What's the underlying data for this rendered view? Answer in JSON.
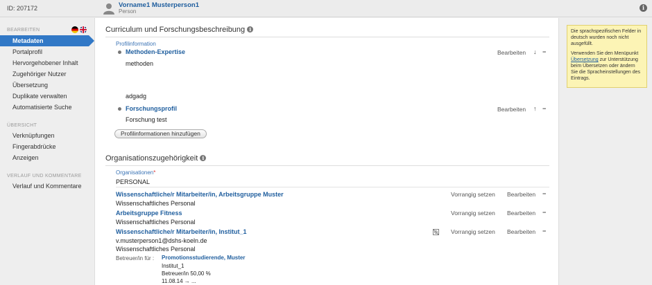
{
  "header": {
    "id_label": "ID: 207172",
    "person_name": "Vorname1 Musterperson1",
    "person_type": "Person"
  },
  "sidebar": {
    "edit_heading": "BEARBEITEN",
    "edit_items": [
      {
        "label": "Metadaten",
        "active": true
      },
      {
        "label": "Portalprofil"
      },
      {
        "label": "Hervorgehobener Inhalt"
      },
      {
        "label": "Zugehöriger Nutzer"
      },
      {
        "label": "Übersetzung"
      },
      {
        "label": "Duplikate verwalten"
      },
      {
        "label": "Automatisierte Suche"
      }
    ],
    "overview_heading": "ÜBERSICHT",
    "overview_items": [
      {
        "label": "Verknüpfungen"
      },
      {
        "label": "Fingerabdrücke"
      },
      {
        "label": "Anzeigen"
      }
    ],
    "history_heading": "VERLAUF UND KOMMENTARE",
    "history_items": [
      {
        "label": "Verlauf und Kommentare"
      }
    ]
  },
  "curriculum": {
    "title": "Curriculum und Forschungsbeschreibung",
    "sublabel": "Profilinformation",
    "entries": [
      {
        "title": "Methoden-Expertise",
        "body_lines": [
          "methoden",
          "adgadg"
        ],
        "edit": "Bearbeiten",
        "move": "↓",
        "remove": "−"
      },
      {
        "title": "Forschungsprofil",
        "body_lines": [
          "Forschung test"
        ],
        "edit": "Bearbeiten",
        "move": "↑",
        "remove": "−"
      }
    ],
    "add_button": "Profilinformationen hinzufügen"
  },
  "organisations": {
    "title": "Organisationszugehörigkeit",
    "sublabel": "Organisationen",
    "required_mark": "*",
    "type_value": "PERSONAL",
    "entries": [
      {
        "title": "Wissenschaftliche/r Mitarbeiter/in, Arbeitsgruppe Muster",
        "lines": [
          "Wissenschaftliches Personal"
        ],
        "primary": "Vorrangig setzen",
        "edit": "Bearbeiten",
        "remove": "−"
      },
      {
        "title": "Arbeitsgruppe Fitness",
        "lines": [
          "Wissenschaftliches Personal"
        ],
        "primary": "Vorrangig setzen",
        "edit": "Bearbeiten",
        "remove": "−"
      },
      {
        "title": "Wissenschaftliche/r Mitarbeiter/in, Institut_1",
        "lines": [
          "v.musterperson1@dshs-koeln.de",
          "Wissenschaftliches Personal"
        ],
        "primary": "Vorrangig setzen",
        "edit": "Bearbeiten",
        "remove": "−"
      }
    ],
    "supervisor": {
      "label": "Betreuer/in für :",
      "name": "Promotionsstudierende, Muster",
      "details": [
        "Institut_1",
        "Betreuer/in 50,00 %",
        "11.08.14 → ..."
      ]
    }
  },
  "note": {
    "para1": "Die sprachspezifischen Felder in deutsch wurden noch nicht ausgefüllt.",
    "para2_before": "Verwenden Sie den Menüpunkt ",
    "para2_link": "Übersetzung",
    "para2_after": " zur Unterstützung beim Übersetzen oder ändern Sie die Spracheinstellungen des Eintrags."
  },
  "colors": {
    "accent": "#3178c6",
    "link": "#1f5e9e",
    "note_bg": "#fcf4b5"
  }
}
